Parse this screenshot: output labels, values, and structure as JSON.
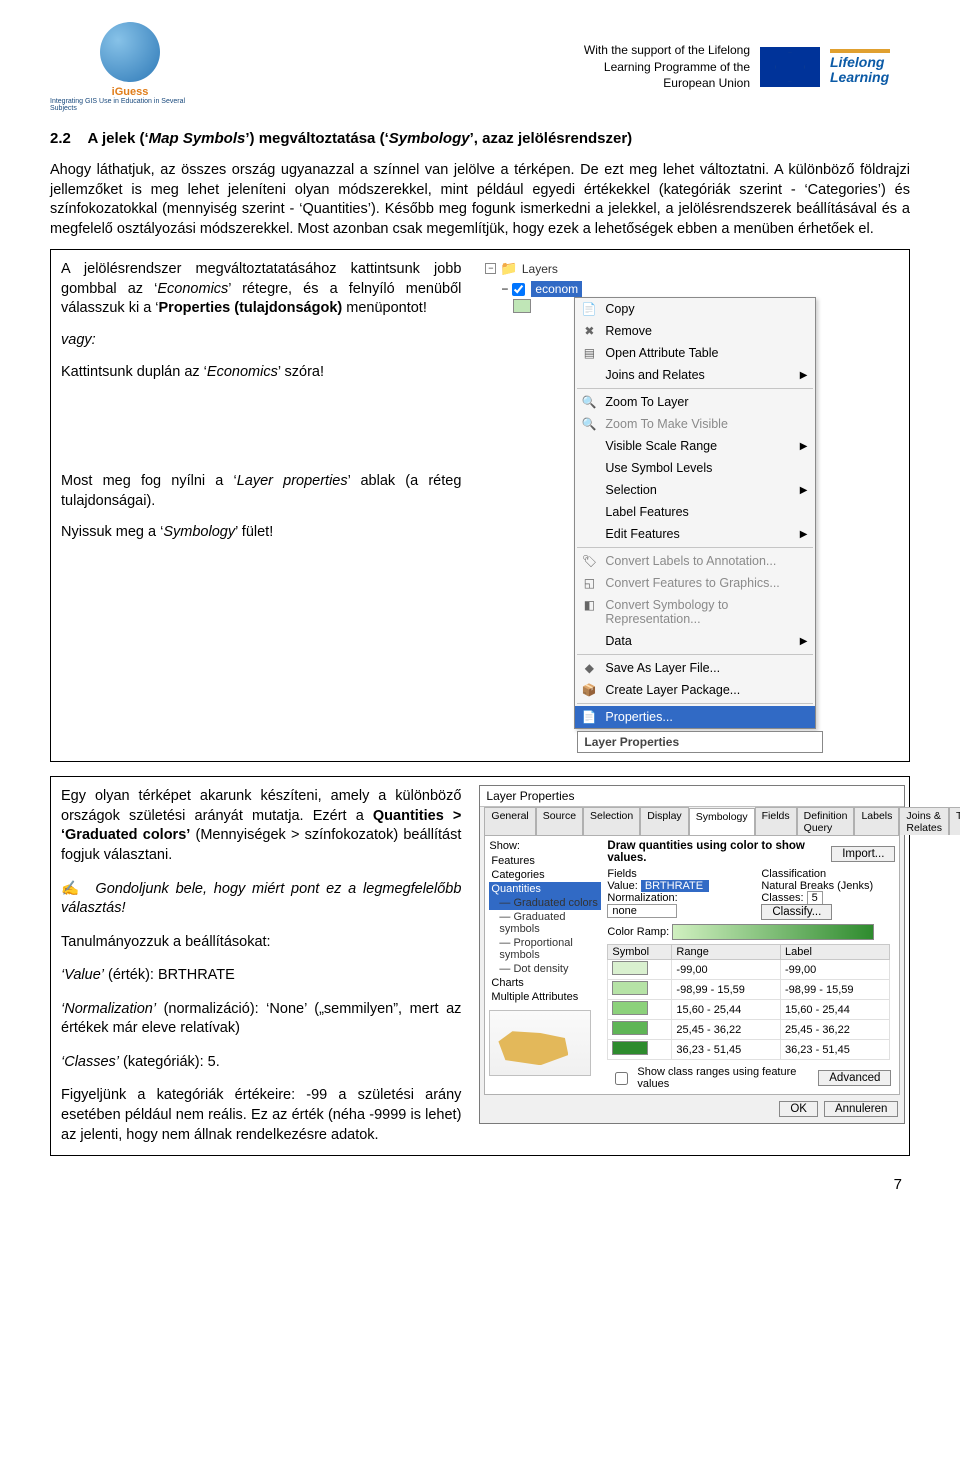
{
  "header": {
    "iguess": "iGuess",
    "iguess_sub": "Integrating GIS Use in Education in Several Subjects",
    "support_lines": [
      "With the support of the Lifelong",
      "Learning Programme of the",
      "European Union"
    ],
    "ll1": "Lifelong",
    "ll2": "Learning"
  },
  "section": {
    "num": "2.2",
    "title": "A jelek (‘Map Symbols’) megváltoztatása (‘Symbology’, azaz jelölésrendszer)"
  },
  "para1": "Ahogy láthatjuk, az összes ország ugyanazzal a színnel van jelölve a térképen. De ezt meg lehet változtatni. A különböző földrajzi jellemzőket is meg lehet jeleníteni olyan módszerekkel, mint például egyedi értékekkel (kategóriák szerint - ‘Categories’) és színfokozatokkal (mennyiség szerint - ‘Quantities’). Később meg fogunk ismerkedni a jelekkel, a jelölésrendszerek beállításával és a megfelelő osztályozási módszerekkel. Most azonban csak megemlítjük, hogy ezek a lehetőségek ebben a menüben érhetőek el.",
  "box1": {
    "p1_a": "A jelölésrendszer megváltoztatatásához kattintsunk jobb gombbal az ‘",
    "p1_b": "Economics",
    "p1_c": "’ rétegre, és a felnyíló menüből válasszuk ki a ‘",
    "p1_d": "Properties (tulajdonságok)",
    "p1_e": " menüpontot!",
    "vagy": "vagy:",
    "p2_a": "Kattintsunk duplán az ‘",
    "p2_b": "Economics",
    "p2_c": "’ szóra!",
    "p3_a": "Most meg fog nyílni a ‘",
    "p3_b": "Layer properties",
    "p3_c": "’ ablak (a réteg tulajdonságai).",
    "p4_a": "Nyissuk meg a ‘",
    "p4_b": "Symbology",
    "p4_c": "’ fület!"
  },
  "layers_panel": {
    "layers": "Layers",
    "layer_name": "econom",
    "swatch_color": "#c0e6b7"
  },
  "ctx": [
    {
      "label": "Copy",
      "icon": "📄"
    },
    {
      "label": "Remove",
      "icon": "✖"
    },
    {
      "label": "Open Attribute Table",
      "icon": "▤"
    },
    {
      "label": "Joins and Relates",
      "arrow": true
    },
    {
      "sep": true
    },
    {
      "label": "Zoom To Layer",
      "icon": "🔍"
    },
    {
      "label": "Zoom To Make Visible",
      "icon": "🔍",
      "disabled": true
    },
    {
      "label": "Visible Scale Range",
      "arrow": true
    },
    {
      "label": "Use Symbol Levels"
    },
    {
      "label": "Selection",
      "arrow": true
    },
    {
      "label": "Label Features"
    },
    {
      "label": "Edit Features",
      "arrow": true
    },
    {
      "sep": true
    },
    {
      "label": "Convert Labels to Annotation...",
      "icon": "🏷",
      "disabled": true
    },
    {
      "label": "Convert Features to Graphics...",
      "icon": "◱",
      "disabled": true
    },
    {
      "label": "Convert Symbology to Representation...",
      "icon": "◧",
      "disabled": true
    },
    {
      "label": "Data",
      "arrow": true
    },
    {
      "sep": true
    },
    {
      "label": "Save As Layer File...",
      "icon": "◆"
    },
    {
      "label": "Create Layer Package...",
      "icon": "📦"
    },
    {
      "sep": true
    },
    {
      "label": "Properties...",
      "icon": "📄",
      "highlight": true
    }
  ],
  "tooltip": "Layer Properties",
  "box2": {
    "p1_a": "Egy olyan térképet akarunk készíteni, amely a különböző országok születési arányát mutatja. Ezért a ",
    "p1_b": "Quantities > ‘Graduated colors’",
    "p1_c": " (Mennyiségek > színfokozatok) beállítást fogjuk választani.",
    "p2": "Gondoljunk bele, hogy miért pont ez a legmegfelelőbb választás!",
    "p3": "Tanulmányozzuk a beállításokat:",
    "p4_a": "‘Value’",
    "p4_b": " (érték): BRTHRATE",
    "p5_a": "‘Normalization’",
    "p5_b": " (normalizáció): ‘None’ („semmilyen”, mert az értékek már eleve relatívak)",
    "p6_a": "‘Classes’",
    "p6_b": " (kategóriák): 5.",
    "p7": "Figyeljünk a kategóriák értékeire: -99 a születési arány esetében például nem reális. Ez az érték (néha -9999 is lehet) az jelenti, hogy nem állnak rendelkezésre adatok."
  },
  "dialog": {
    "title": "Layer Properties",
    "tabs": [
      "General",
      "Source",
      "Selection",
      "Display",
      "Symbology",
      "Fields",
      "Definition Query",
      "Labels",
      "Joins & Relates",
      "Time"
    ],
    "active_tab": 4,
    "show_label": "Show:",
    "show_items": [
      {
        "label": "Features"
      },
      {
        "label": "Categories"
      },
      {
        "label": "Quantities",
        "sel": true
      },
      {
        "label": "Graduated colors",
        "sub": true,
        "sel": true
      },
      {
        "label": "Graduated symbols",
        "sub": true
      },
      {
        "label": "Proportional symbols",
        "sub": true
      },
      {
        "label": "Dot density",
        "sub": true
      },
      {
        "label": "Charts"
      },
      {
        "label": "Multiple Attributes"
      }
    ],
    "desc": "Draw quantities using color to show values.",
    "import": "Import...",
    "fields_h": "Fields",
    "class_h": "Classification",
    "value_l": "Value:",
    "value_v": "BRTHRATE",
    "norm_l": "Normalization:",
    "norm_v": "none",
    "class_l": "Classes:",
    "class_v": "5",
    "method": "Natural Breaks (Jenks)",
    "classify": "Classify...",
    "ramp_l": "Color Ramp:",
    "table": {
      "cols": [
        "Symbol",
        "Range",
        "Label"
      ],
      "rows": [
        {
          "c": "#d9f0cf",
          "range": "-99,00",
          "label": "-99,00"
        },
        {
          "c": "#b6e3a6",
          "range": "-98,99 - 15,59",
          "label": "-98,99 - 15,59"
        },
        {
          "c": "#8cd17b",
          "range": "15,60 - 25,44",
          "label": "15,60 - 25,44"
        },
        {
          "c": "#5fb556",
          "range": "25,45 - 36,22",
          "label": "25,45 - 36,22"
        },
        {
          "c": "#2e8b2e",
          "range": "36,23 - 51,45",
          "label": "36,23 - 51,45"
        }
      ]
    },
    "show_ranges": "Show class ranges using feature values",
    "advanced": "Advanced",
    "ok": "OK",
    "cancel": "Annuleren"
  },
  "page_number": "7"
}
